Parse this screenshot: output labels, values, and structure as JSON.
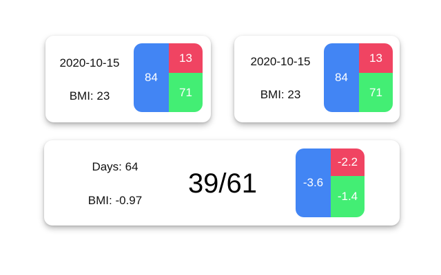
{
  "colors": {
    "blue": "#4285f4",
    "red": "#f04462",
    "green": "#43ee74"
  },
  "cards": [
    {
      "date": "2020-10-15",
      "bmi": "BMI: 23",
      "blue_value": "84",
      "red_value": "13",
      "green_value": "71"
    },
    {
      "date": "2020-10-15",
      "bmi": "BMI: 23",
      "blue_value": "84",
      "red_value": "13",
      "green_value": "71"
    }
  ],
  "summary": {
    "days": "Days: 64",
    "bmi": "BMI: -0.97",
    "ratio": "39/61",
    "blue_value": "-3.6",
    "red_value": "-2.2",
    "green_value": "-1.4"
  }
}
